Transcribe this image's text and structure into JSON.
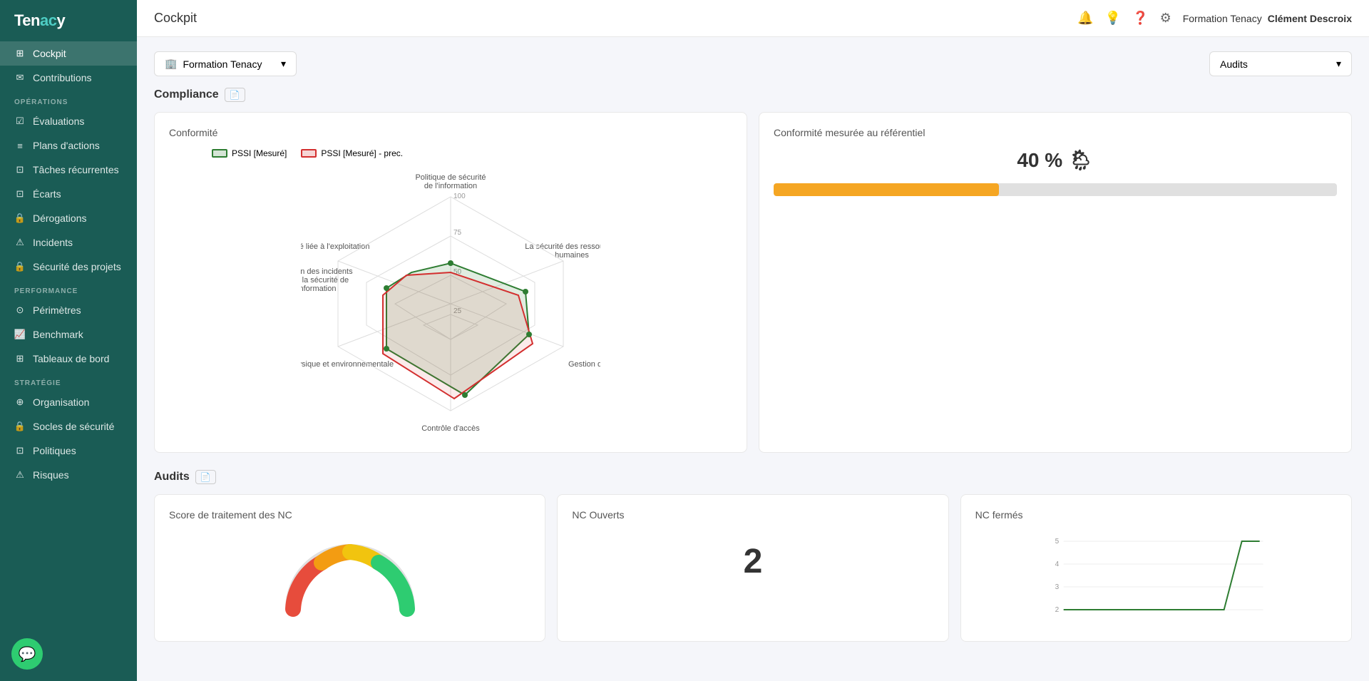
{
  "app": {
    "name": "Tenacy",
    "name_highlight": "y"
  },
  "header": {
    "title": "Cockpit",
    "user_org": "Formation Tenacy",
    "user_name": "Clément Descroix"
  },
  "sidebar": {
    "nav_top": [
      {
        "id": "cockpit",
        "label": "Cockpit",
        "icon": "⊞",
        "active": true
      },
      {
        "id": "contributions",
        "label": "Contributions",
        "icon": "✉"
      }
    ],
    "sections": [
      {
        "label": "OPÉRATIONS",
        "items": [
          {
            "id": "evaluations",
            "label": "Évaluations",
            "icon": "☑"
          },
          {
            "id": "plans",
            "label": "Plans d'actions",
            "icon": "≡"
          },
          {
            "id": "taches",
            "label": "Tâches récurrentes",
            "icon": "⊡"
          },
          {
            "id": "ecarts",
            "label": "Écarts",
            "icon": "⊡"
          },
          {
            "id": "derogations",
            "label": "Dérogations",
            "icon": "🔒"
          },
          {
            "id": "incidents",
            "label": "Incidents",
            "icon": "⚠"
          },
          {
            "id": "securite",
            "label": "Sécurité des projets",
            "icon": "🔒"
          }
        ]
      },
      {
        "label": "PERFORMANCE",
        "items": [
          {
            "id": "perimetres",
            "label": "Périmètres",
            "icon": "⊙"
          },
          {
            "id": "benchmark",
            "label": "Benchmark",
            "icon": "📈"
          },
          {
            "id": "tableaux",
            "label": "Tableaux de bord",
            "icon": "⊞"
          }
        ]
      },
      {
        "label": "STRATÉGIE",
        "items": [
          {
            "id": "organisation",
            "label": "Organisation",
            "icon": "⊕"
          },
          {
            "id": "socles",
            "label": "Socles de sécurité",
            "icon": "🔒"
          },
          {
            "id": "politiques",
            "label": "Politiques",
            "icon": "⊡"
          },
          {
            "id": "risques",
            "label": "Risques",
            "icon": "⚠"
          }
        ]
      }
    ]
  },
  "filters": {
    "org_label": "Formation Tenacy",
    "audit_label": "Audits"
  },
  "compliance_section": {
    "title": "Compliance",
    "radar_title": "Conformité",
    "legend": [
      {
        "label": "PSSI [Mesuré]",
        "color": "#2e7d32"
      },
      {
        "label": "PSSI [Mesuré] - prec.",
        "color": "#d32f2f"
      }
    ],
    "radar_labels": [
      "Politique de sécurité de l'information",
      "La sécurité des ressources humaines",
      "Gestion des actifs",
      "Contrôle d'accès",
      "Sécurité physique et environnementale",
      "Sécurité liée à l'exploitation",
      "Gestion des incidents liés à la sécurité de l'information"
    ],
    "conformity_card_title": "Conformité mesurée au référentiel",
    "conformity_percent": "40 %",
    "conformity_value": 40,
    "conformity_icon": "🌦"
  },
  "audits_section": {
    "title": "Audits",
    "cards": [
      {
        "id": "score",
        "title": "Score de traitement des NC"
      },
      {
        "id": "nc_ouverts",
        "title": "NC Ouverts",
        "value": "2"
      },
      {
        "id": "nc_fermes",
        "title": "NC fermés"
      }
    ]
  }
}
